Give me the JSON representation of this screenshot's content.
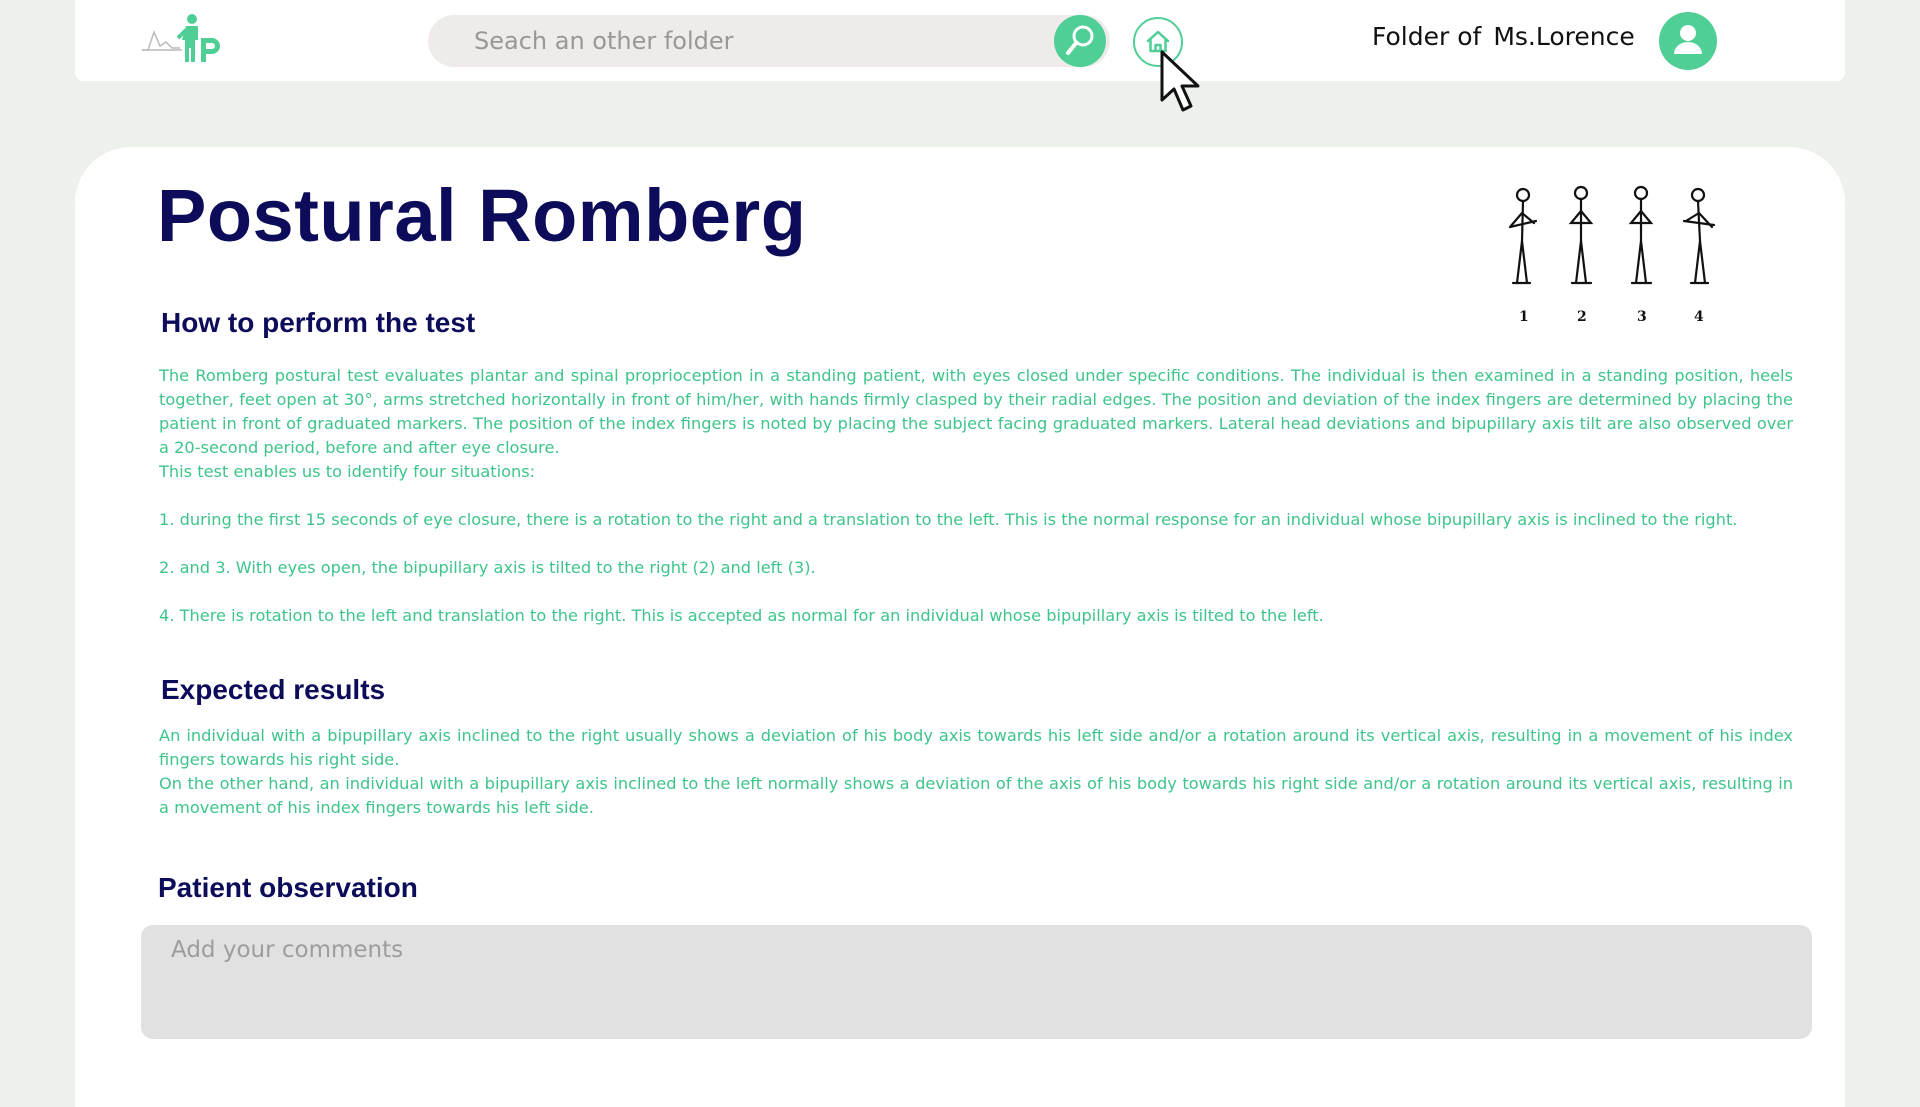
{
  "header": {
    "search_placeholder": "Seach an other folder",
    "folder_prefix": "Folder of",
    "patient_name": "Ms.Lorence",
    "icons": {
      "logo": "doctor-logo-icon",
      "search": "magnifier-icon",
      "home": "home-icon",
      "user": "user-icon",
      "cursor": "mouse-pointer-icon"
    }
  },
  "page": {
    "title": "Postural Romberg",
    "figure_labels": [
      "1",
      "2",
      "3",
      "4"
    ],
    "how_heading": "How to perform the test",
    "how_intro": "The Romberg postural test evaluates plantar and spinal proprioception in a standing patient, with eyes closed under specific conditions. The individual is then examined in a standing position, heels together, feet open at 30°, arms stretched horizontally in front of him/her, with hands firmly clasped by their radial edges. The position and deviation of the index fingers are determined by placing the patient in front of graduated markers. The position of the index fingers is noted by placing the subject facing graduated markers. Lateral head deviations and bipupillary axis tilt are also observed over a 20-second period, before and after eye closure.",
    "how_lead": "This test enables us to identify four situations:",
    "situations": [
      "1. during the first 15 seconds of eye closure, there is a rotation to the right and a translation to the left. This is the normal response for an individual whose bipupillary axis is inclined to the right.",
      "2. and 3. With eyes open, the bipupillary axis is tilted to the right (2) and left (3).",
      "4. There is rotation to the left and translation to the right. This is accepted as normal for an individual whose bipupillary axis is tilted to the left."
    ],
    "expected_heading": "Expected results",
    "expected_p1": "An individual with a bipupillary axis inclined to the right usually shows a deviation of his body axis towards his left side and/or a rotation around its vertical axis, resulting in a movement of his index fingers towards his right side.",
    "expected_p2": "On the other hand, an individual with a bipupillary axis inclined to the left normally shows a deviation of the axis of his body towards his right side and/or a rotation around its vertical axis, resulting in a movement of his index fingers towards his left side.",
    "observation_heading": "Patient observation",
    "comments_placeholder": "Add your comments"
  },
  "colors": {
    "accent": "#4fcf95",
    "heading": "#0c0c5a",
    "body_text": "#3ec48b",
    "background": "#edf1ec"
  }
}
